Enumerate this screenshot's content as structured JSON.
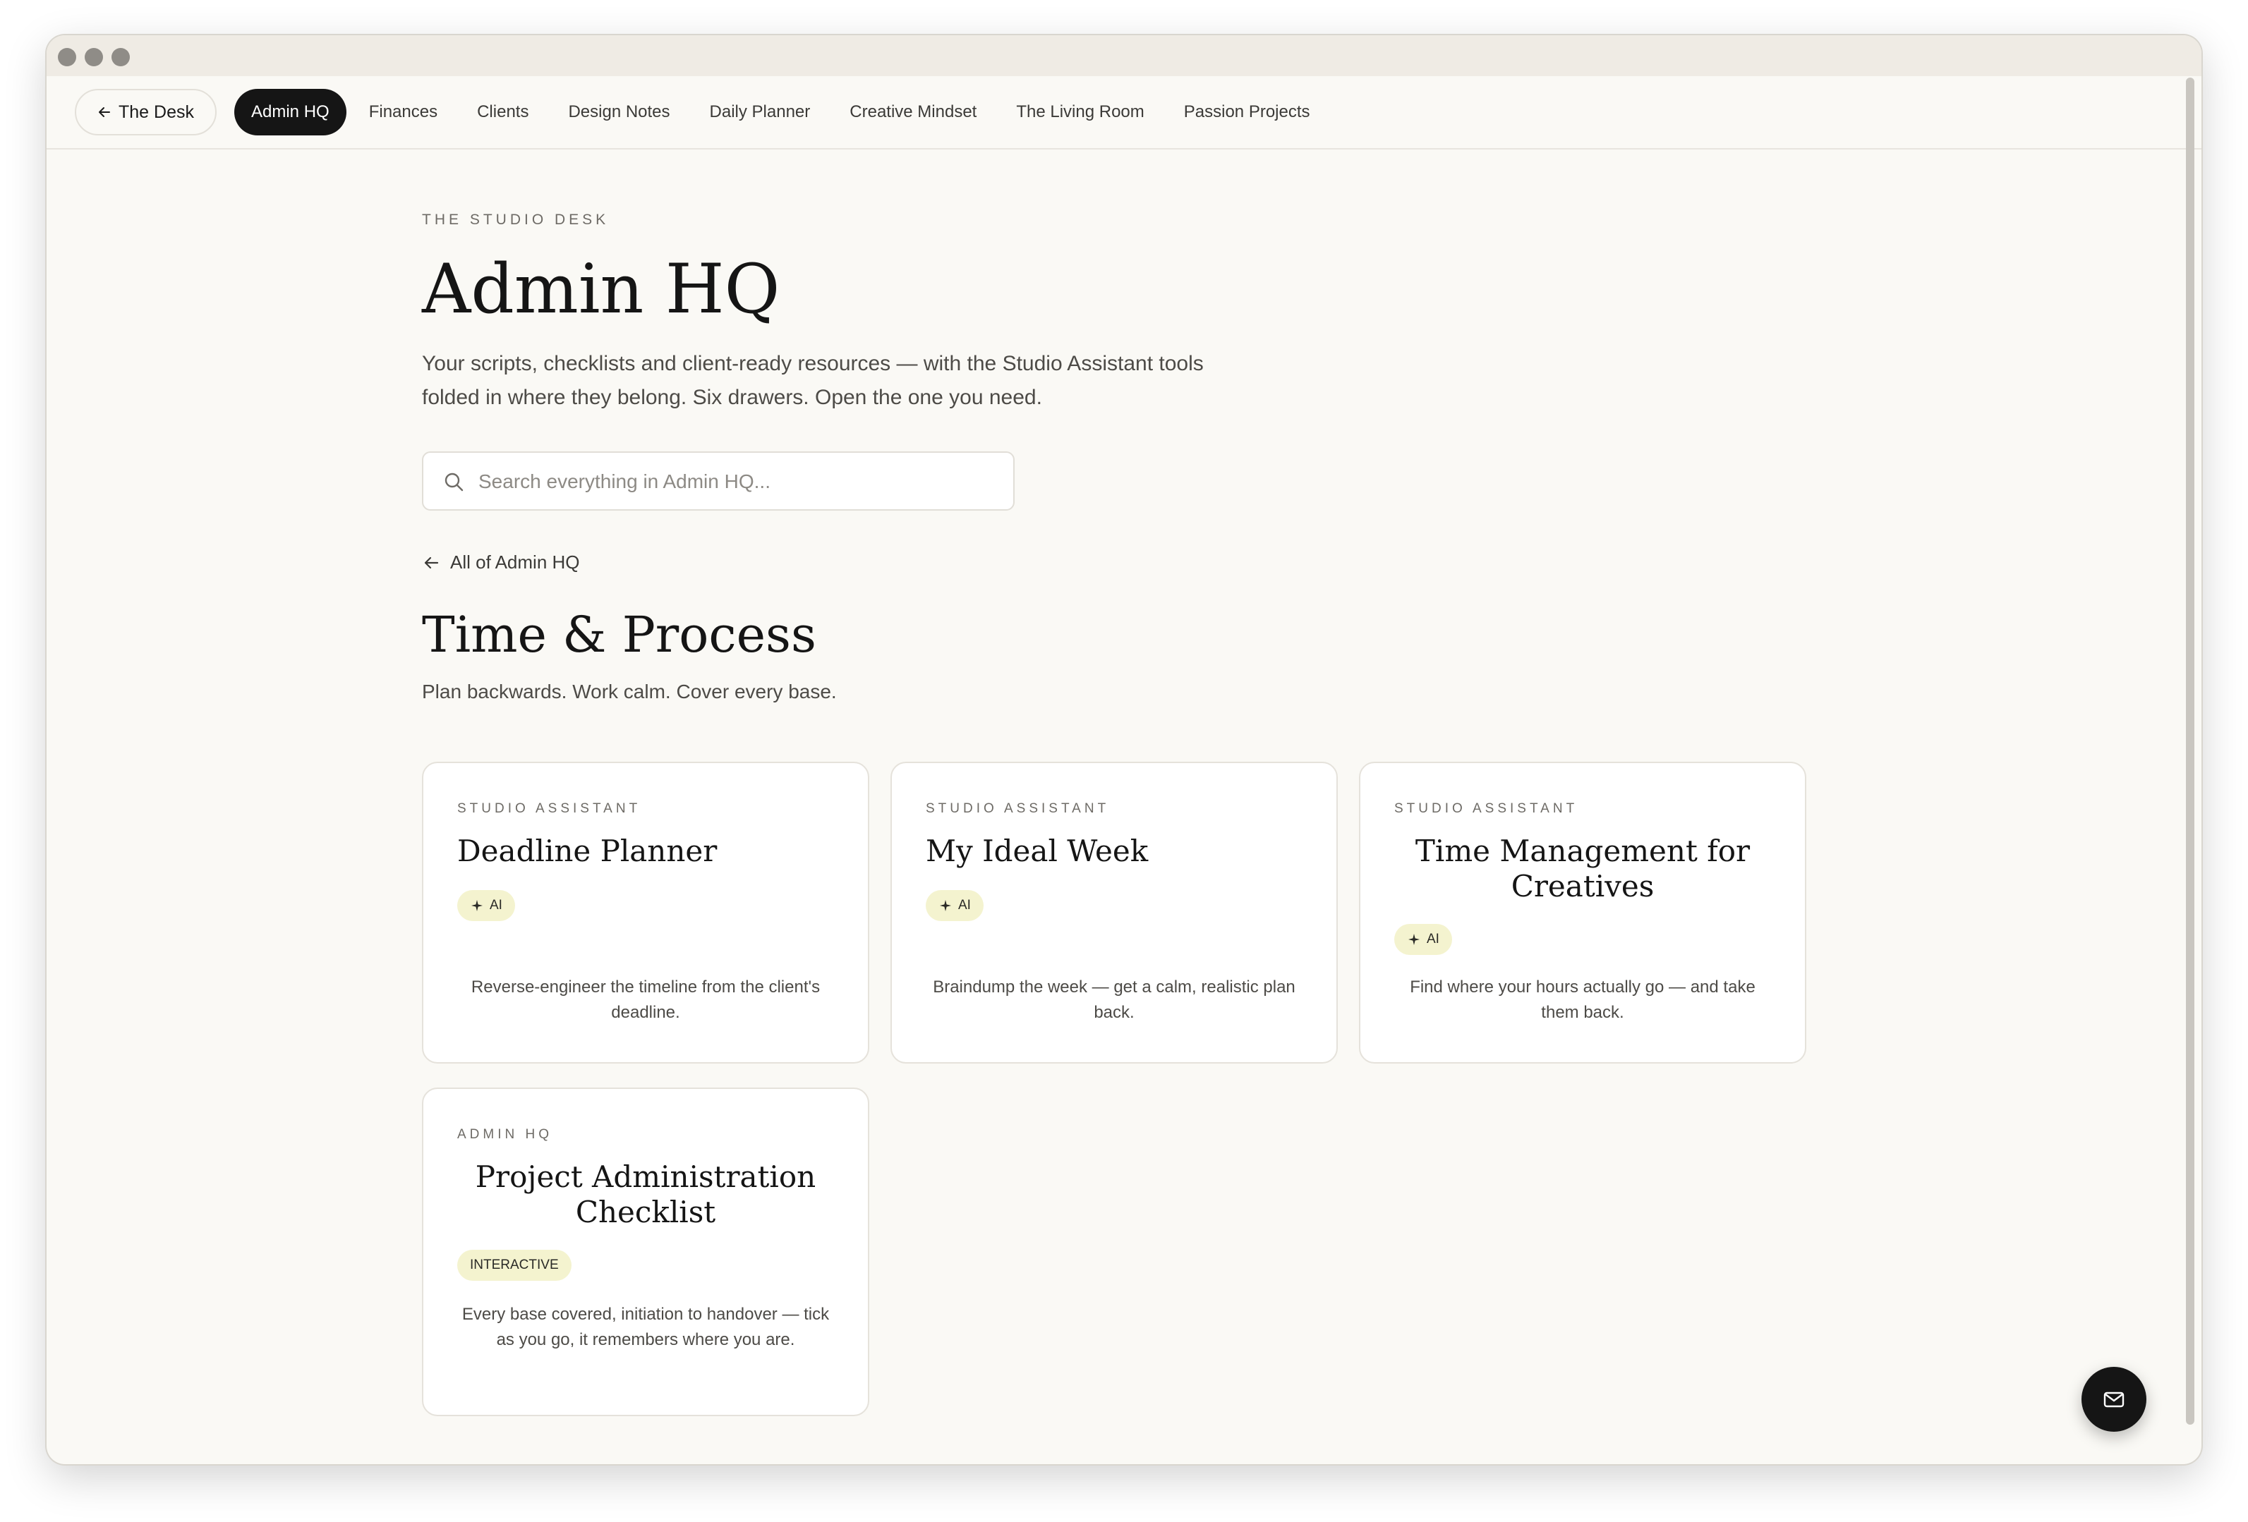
{
  "nav": {
    "back_label": "The Desk",
    "items": [
      {
        "label": "Admin HQ",
        "active": true
      },
      {
        "label": "Finances",
        "active": false
      },
      {
        "label": "Clients",
        "active": false
      },
      {
        "label": "Design Notes",
        "active": false
      },
      {
        "label": "Daily Planner",
        "active": false
      },
      {
        "label": "Creative Mindset",
        "active": false
      },
      {
        "label": "The Living Room",
        "active": false
      },
      {
        "label": "Passion Projects",
        "active": false
      }
    ]
  },
  "page": {
    "eyebrow": "THE STUDIO DESK",
    "title": "Admin HQ",
    "intro": "Your scripts, checklists and client-ready resources — with the Studio Assistant tools folded in where they belong. Six drawers. Open the one you need."
  },
  "search": {
    "placeholder": "Search everything in Admin HQ...",
    "value": ""
  },
  "back_link": "All of Admin HQ",
  "section": {
    "title": "Time & Process",
    "subtitle": "Plan backwards. Work calm. Cover every base."
  },
  "cards": [
    {
      "label": "STUDIO ASSISTANT",
      "title": "Deadline Planner",
      "badge": "AI",
      "badge_icon": "sparkle-icon",
      "description": "Reverse-engineer the timeline from the client's deadline."
    },
    {
      "label": "STUDIO ASSISTANT",
      "title": "My Ideal Week",
      "badge": "AI",
      "badge_icon": "sparkle-icon",
      "description": "Braindump the week — get a calm, realistic plan back."
    },
    {
      "label": "STUDIO ASSISTANT",
      "title": "Time Management for Creatives",
      "badge": "AI",
      "badge_icon": "sparkle-icon",
      "description": "Find where your hours actually go — and take them back."
    },
    {
      "label": "ADMIN HQ",
      "title": "Project Administration Checklist",
      "badge": "INTERACTIVE",
      "badge_icon": "",
      "description": "Every base covered, initiation to handover — tick as you go, it remembers where you are."
    }
  ],
  "fab": {
    "icon": "mail-icon"
  },
  "colors": {
    "background": "#faf9f5",
    "active_nav": "#151515",
    "badge_bg": "#f4f3cf",
    "card_border": "#e5e2db"
  }
}
